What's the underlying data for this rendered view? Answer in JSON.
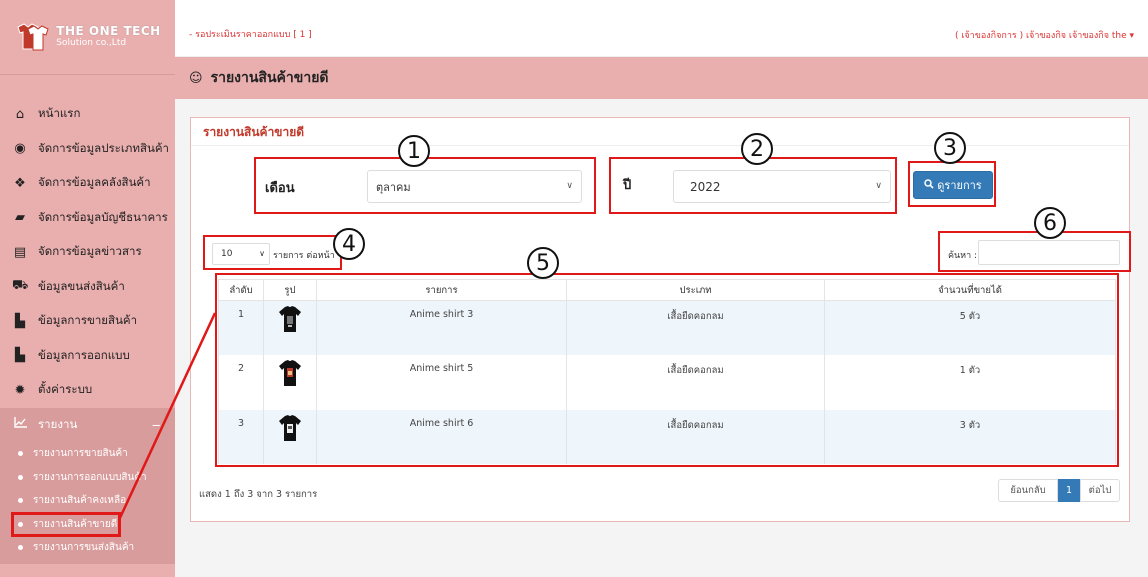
{
  "logo": {
    "line1": "THE ONE TECH",
    "line2": "Solution co.,Ltd"
  },
  "topbar": {
    "notice": "- รอประเมินราคาออกแบบ [ 1 ]",
    "user": "( เจ้าของกิจการ ) เจ้าของกิจ เจ้าของกิจ the ▾"
  },
  "sidebar": {
    "items": [
      {
        "label": "หน้าแรก",
        "icon": "home-icon"
      },
      {
        "label": "จัดการข้อมูลประเภทสินค้า",
        "icon": "product-type-icon"
      },
      {
        "label": "จัดการข้อมูลคลังสินค้า",
        "icon": "warehouse-icon"
      },
      {
        "label": "จัดการข้อมูลบัญชีธนาคาร",
        "icon": "bank-icon"
      },
      {
        "label": "จัดการข้อมูลข่าวสาร",
        "icon": "news-icon"
      },
      {
        "label": "ข้อมูลขนส่งสินค้า",
        "icon": "truck-icon"
      },
      {
        "label": "ข้อมูลการขายสินค้า",
        "icon": "file-icon"
      },
      {
        "label": "ข้อมูลการออกแบบ",
        "icon": "file-icon"
      },
      {
        "label": "ตั้งค่าระบบ",
        "icon": "gear-icon"
      }
    ],
    "report": {
      "label": "รายงาน",
      "toggle": "−"
    },
    "subitems": [
      "รายงานการขายสินค้า",
      "รายงานการออกแบบสินค้า",
      "รายงานสินค้าคงเหลือ",
      "รายงานสินค้าขายดี",
      "รายงานการขนส่งสินค้า"
    ]
  },
  "page": {
    "title": "รายงานสินค้าขายดี"
  },
  "panel": {
    "title": "รายงานสินค้าขายดี"
  },
  "filters": {
    "month_label": "เดือน",
    "month_value": "ตุลาคม",
    "year_label": "ปี",
    "year_value": "2022",
    "button_label": "ดูรายการ"
  },
  "table_controls": {
    "page_length": "10",
    "page_length_label": "รายการ ต่อหน้า",
    "search_label": "ค้นหา :"
  },
  "table": {
    "headers": [
      "ลำดับ",
      "รูป",
      "รายการ",
      "ประเภท",
      "จำนวนที่ขายได้"
    ],
    "rows": [
      {
        "no": "1",
        "name": "Anime shirt 3",
        "type": "เสื้อยืดคอกลม",
        "qty": "5 ตัว"
      },
      {
        "no": "2",
        "name": "Anime shirt 5",
        "type": "เสื้อยืดคอกลม",
        "qty": "1 ตัว"
      },
      {
        "no": "3",
        "name": "Anime shirt 6",
        "type": "เสื้อยืดคอกลม",
        "qty": "3 ตัว"
      }
    ]
  },
  "footer": {
    "info": "แสดง 1 ถึง 3 จาก 3 รายการ",
    "prev": "ย้อนกลับ",
    "current": "1",
    "next": "ต่อไป"
  },
  "annotations": [
    "1",
    "2",
    "3",
    "4",
    "5",
    "6"
  ],
  "colors": {
    "sidebar": "#e9aeae",
    "accent": "#337ab7",
    "highlight": "#e01818"
  }
}
